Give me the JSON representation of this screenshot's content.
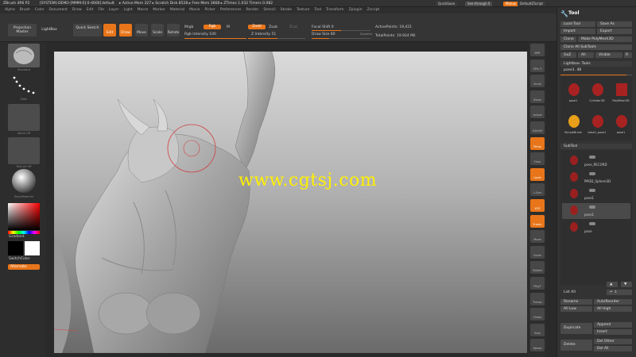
{
  "titlebar": {
    "app": "ZBrush 4R6 P2",
    "doc": "[SYSTEM]-DEMO-[MMM:0]:0-4600]",
    "preset": "default",
    "stats": "▸ Active Mem 327 ▸ Scratch Disk 8528 ▸ Free Mem 3668 ▸ ZTimes 1.032 Timers 0.082",
    "quicksave": "QuickSave",
    "seethrough": "See-through 0",
    "menus_btn": "Menus",
    "script": "DefaultZScript",
    "coords": "-0.456,2.657,3.324"
  },
  "menubar": [
    "Alpha",
    "Brush",
    "Color",
    "Document",
    "Draw",
    "Edit",
    "File",
    "Layer",
    "Light",
    "Macro",
    "Marker",
    "Material",
    "Movie",
    "Picker",
    "Preferences",
    "Render",
    "Stencil",
    "Stroke",
    "Texture",
    "Tool",
    "Transform",
    "Zplugin",
    "Zscript"
  ],
  "toolbar": {
    "projection_master": "Projection Master",
    "lightbox": "LightBox",
    "quick_sketch": "Quick Sketch",
    "edit": "Edit",
    "draw": "Draw",
    "move": "Move",
    "scale": "Scale",
    "rotate": "Rotate",
    "mrgb": "Mrgb",
    "rgb": "Rgb",
    "m": "M",
    "zadd": "Zadd",
    "zsub": "Zsub",
    "zcut": "Zcut",
    "rgb_intensity": "Rgb Intensity 100",
    "z_intensity": "Z Intensity 51",
    "focal_shift": "Focal Shift 0",
    "draw_size": "Draw Size 80",
    "dynamic": "Dynamic",
    "active_points": "ActivePoints: 19,421",
    "total_points": "TotalPoints: 19.924 Mil"
  },
  "left_shelf": {
    "brush": "Standard",
    "stroke": "Dots",
    "alpha": "Alpha Off",
    "texture": "Texture Off",
    "material": "BasicMaterial",
    "gradient": "Gradient",
    "switch_color": "SwitchColor",
    "alternate": "Alternate"
  },
  "canvas": {
    "watermark": "www.cgtsj.com"
  },
  "right_shelf": [
    "BPR",
    "SPix 3",
    "Scroll",
    "Zoom",
    "Actual",
    "AAHalf",
    "Persp",
    "Floor",
    "Local",
    "L.Sym",
    "XYZ",
    "Frame",
    "Move",
    "Scale",
    "Rotate",
    "PolyF",
    "Transp",
    "Ghost",
    "Solo",
    "Xpose"
  ],
  "tool_panel": {
    "title": "Tool",
    "load_tool": "Load Tool",
    "save_as": "Save As",
    "import": "Import",
    "export": "Export",
    "clone": "Clone",
    "make_polymesh": "Make PolyMesh3D",
    "clone_all": "Clone All SubTools",
    "goz": "GoZ",
    "all": "All",
    "visible": "Visible",
    "r": "R",
    "lightbox_tools": "Lightbox› Tools",
    "current_tool": "pose1. 48",
    "tools": [
      "pose1",
      "Cylinder3D",
      "PolyMesh3D",
      "SimpleBrush",
      "base1_pose1",
      "pose1"
    ],
    "subtool_header": "SubTool",
    "subtools": [
      "pose_RECORD",
      "PM3D_Sphere3D",
      "pose1",
      "pose1",
      "pose"
    ],
    "list_all": "List All",
    "rename": "Rename",
    "auto_reorder": "AutoReorder",
    "all_low": "All Low",
    "all_high": "All High",
    "duplicate": "Duplicate",
    "append": "Append",
    "insert": "Insert",
    "delete": "Delete",
    "del_other": "Del Other",
    "del_all": "Del All"
  },
  "colors": {
    "accent": "#e8751a",
    "watermark": "#fff000",
    "brush_ring": "#d04040"
  }
}
